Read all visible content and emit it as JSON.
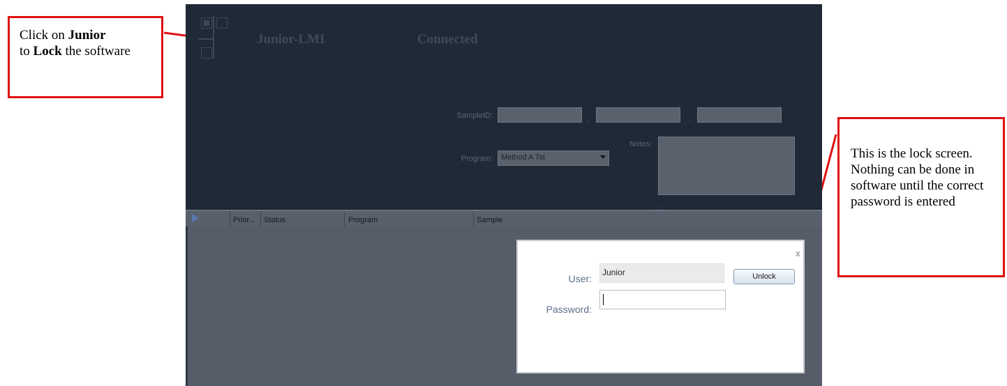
{
  "annotations": {
    "left": {
      "pre": "Click on ",
      "bold1": "Junior",
      "mid": "to ",
      "bold2": "Lock",
      "post": " the software"
    },
    "right": {
      "text": "This is the lock screen.  Nothing can be done in software until the correct password is entered"
    },
    "border_color": "#e01010"
  },
  "app": {
    "title": "Junior-LMI",
    "status": "Connected",
    "logo_icon": "grid-logo-icon",
    "form": {
      "sample_id_label": "SampleID:",
      "separator": ".",
      "program_label": "Program:",
      "program_value": "Method A Tst",
      "notes_label": "Notes:"
    },
    "table": {
      "columns": [
        "Prior...",
        "Status",
        "Program",
        "Sample"
      ]
    }
  },
  "dialog": {
    "close": "x",
    "user_label": "User:",
    "user_value": "Junior",
    "password_label": "Password:",
    "password_value": "",
    "unlock_label": "Unlock"
  },
  "colors": {
    "app_bg": "#202a37",
    "table_bg": "#565d69",
    "dialog_bg": "#ffffff"
  }
}
